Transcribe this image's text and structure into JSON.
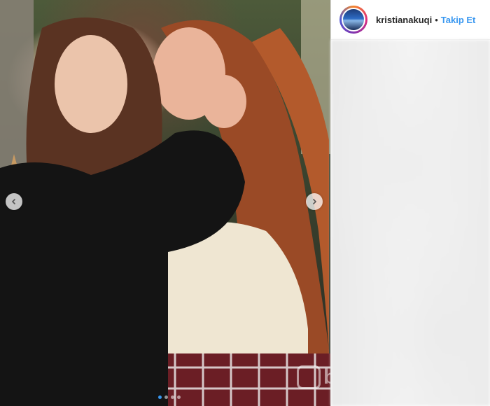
{
  "post": {
    "username": "kristianakuqi",
    "separator": "•",
    "follow_label": "Takip Et"
  },
  "carousel": {
    "slide_count": 4,
    "active_index": 0
  },
  "watermark": {
    "text": "bursa"
  },
  "colors": {
    "follow": "#3897f0",
    "panel_bg": "#ffffff",
    "active_dot": "#3897f0"
  },
  "icons": {
    "prev": "chevron-left-icon",
    "next": "chevron-right-icon"
  }
}
